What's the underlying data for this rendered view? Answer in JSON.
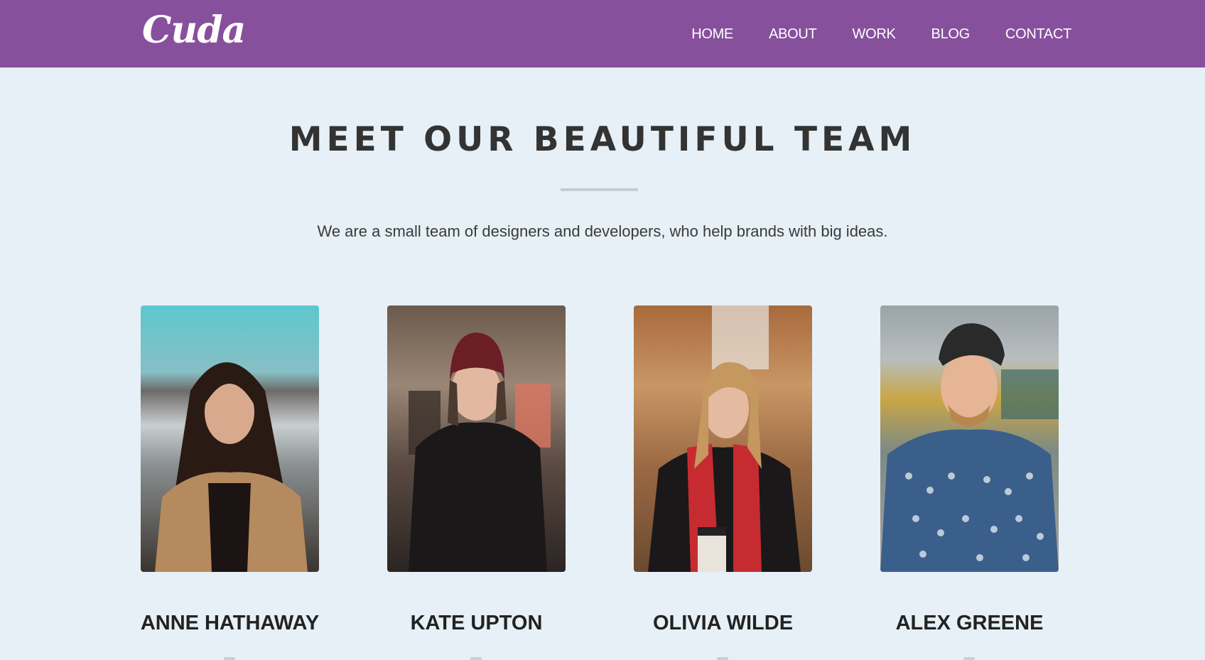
{
  "navbar": {
    "logo_text": "Cuda",
    "links": [
      "HOME",
      "ABOUT",
      "WORK",
      "BLOG",
      "CONTACT"
    ]
  },
  "team": {
    "title": "MEET OUR BEAUTIFUL TEAM",
    "subtitle": "We are a small team of designers and developers, who help brands with big ideas.",
    "members": [
      {
        "name": "ANNE HATHAWAY"
      },
      {
        "name": "KATE UPTON"
      },
      {
        "name": "OLIVIA WILDE"
      },
      {
        "name": "ALEX GREENE"
      }
    ]
  },
  "colors": {
    "header_bg": "#87509c",
    "page_bg": "#e6f0f6",
    "heading_text": "#333333"
  }
}
